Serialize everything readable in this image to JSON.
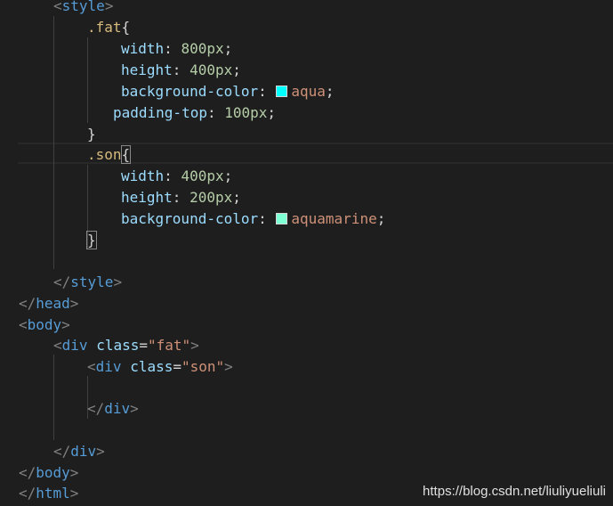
{
  "colors": {
    "background": "#1e1e1e",
    "aqua": "#00ffff",
    "aquamarine": "#7fffd4"
  },
  "lines": {
    "l1_tag": "style",
    "l2_sel": ".fat",
    "l3_prop": "width",
    "l3_val": "800px",
    "l4_prop": "height",
    "l4_val": "400px",
    "l5_prop": "background-color",
    "l5_val": "aqua",
    "l6_prop": "padding-top",
    "l6_val": "100px",
    "l8_sel": ".son",
    "l9_prop": "width",
    "l9_val": "400px",
    "l10_prop": "height",
    "l10_val": "200px",
    "l11_prop": "background-color",
    "l11_val": "aquamarine",
    "l14_tag": "style",
    "l15_tag": "head",
    "l16_tag": "body",
    "l17_tag": "div",
    "l17_attr": "class",
    "l17_str": "\"fat\"",
    "l18_tag": "div",
    "l18_attr": "class",
    "l18_str": "\"son\"",
    "l20_tag": "div",
    "l22_tag": "div",
    "l23_tag": "body",
    "l24_tag": "html"
  },
  "watermark": "https://blog.csdn.net/liuliyueliuli"
}
